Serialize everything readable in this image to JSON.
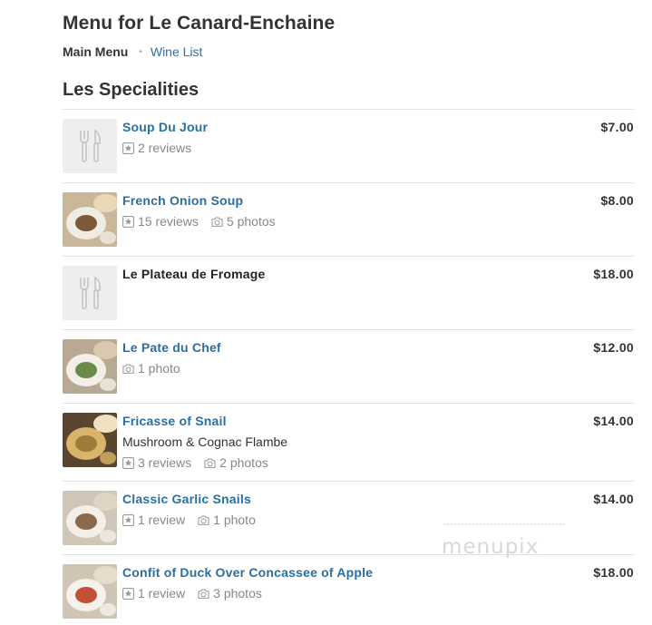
{
  "page": {
    "title": "Menu for Le Canard-Enchaine",
    "tabs": [
      {
        "label": "Main Menu",
        "active": true
      },
      {
        "label": "Wine List",
        "active": false
      }
    ],
    "tab_separator": "•"
  },
  "section": {
    "title": "Les Specialities",
    "items": [
      {
        "name": "Soup Du Jour",
        "price": "$7.00",
        "is_link": true,
        "thumb": "placeholder",
        "reviews": "2 reviews",
        "photos": "",
        "description": ""
      },
      {
        "name": "French Onion Soup",
        "price": "$8.00",
        "is_link": true,
        "thumb": "photo",
        "reviews": "15 reviews",
        "photos": "5 photos",
        "description": ""
      },
      {
        "name": "Le Plateau de Fromage",
        "price": "$18.00",
        "is_link": false,
        "thumb": "placeholder",
        "reviews": "",
        "photos": "",
        "description": ""
      },
      {
        "name": "Le Pate du Chef",
        "price": "$12.00",
        "is_link": true,
        "thumb": "photo",
        "reviews": "",
        "photos": "1 photo",
        "description": ""
      },
      {
        "name": "Fricasse of Snail",
        "price": "$14.00",
        "is_link": true,
        "thumb": "photo",
        "reviews": "3 reviews",
        "photos": "2 photos",
        "description": "Mushroom & Cognac Flambe"
      },
      {
        "name": "Classic Garlic Snails",
        "price": "$14.00",
        "is_link": true,
        "thumb": "photo",
        "reviews": "1 review",
        "photos": "1 photo",
        "description": ""
      },
      {
        "name": "Confit of Duck Over Concassee of Apple",
        "price": "$18.00",
        "is_link": true,
        "thumb": "photo",
        "reviews": "1 review",
        "photos": "3 photos",
        "description": ""
      }
    ]
  },
  "watermark": "menupix",
  "colors": {
    "link": "#2a6fa0",
    "text": "#333333",
    "muted": "#888888",
    "divider": "#e3e3e3",
    "placeholder_bg": "#eeeeee"
  }
}
